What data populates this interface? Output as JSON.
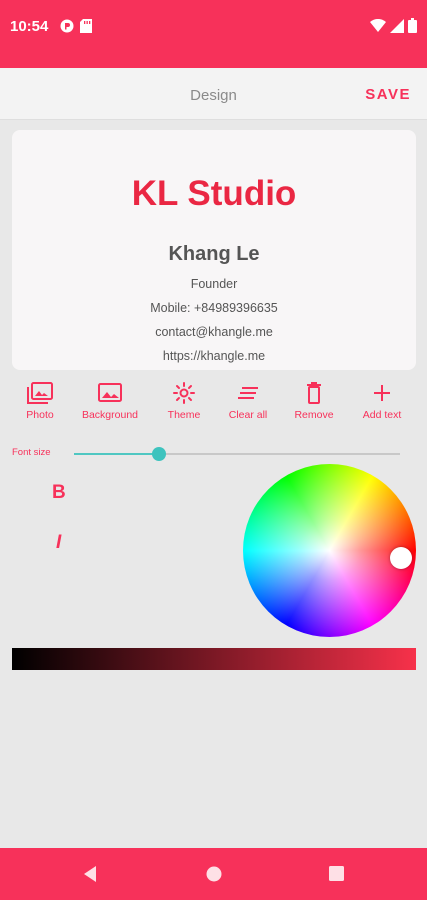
{
  "status_bar": {
    "time": "10:54",
    "icons_left": [
      "vpn-key-icon",
      "sd-card-icon"
    ],
    "icons_right": [
      "wifi-icon",
      "cellular-signal-icon",
      "battery-icon"
    ]
  },
  "app_bar": {
    "title": "Design",
    "save_label": "SAVE"
  },
  "card": {
    "company": "KL Studio",
    "name": "Khang Le",
    "title": "Founder",
    "mobile": "Mobile: +84989396635",
    "email": "contact@khangle.me",
    "website": "https://khangle.me"
  },
  "toolbar": {
    "photo": "Photo",
    "background": "Background",
    "theme": "Theme",
    "clear_all": "Clear all",
    "remove": "Remove",
    "add_text": "Add text"
  },
  "font_size": {
    "label": "Font size",
    "value_fraction": 0.26
  },
  "format": {
    "bold": "B",
    "italic": "I"
  },
  "colors": {
    "accent": "#f7315a",
    "card_title": "#ea2743",
    "slider": "#3ec3be"
  },
  "nav": {
    "back": "back-icon",
    "home": "home-icon",
    "recents": "recents-icon"
  }
}
